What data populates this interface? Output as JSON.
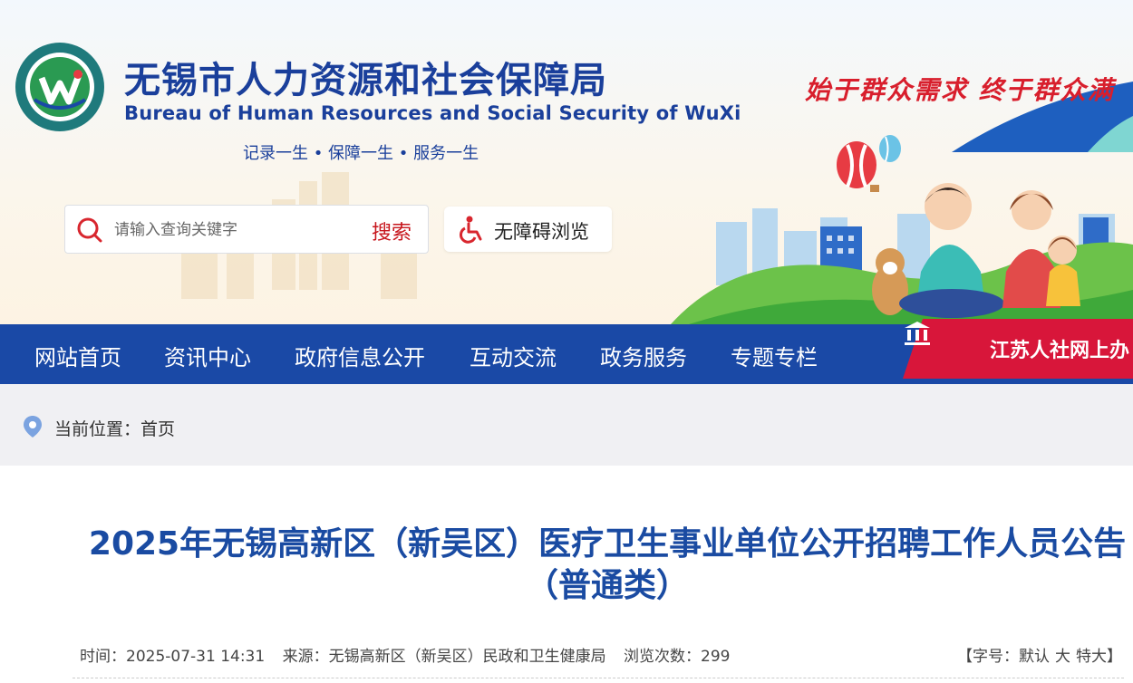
{
  "header": {
    "title": "无锡市人力资源和社会保障局",
    "subtitle": "Bureau of  Human Resources and Social Security of WuXi",
    "tagline": "记录一生 • 保障一生 • 服务一生",
    "slogan": "始于群众需求  终于群众满",
    "search": {
      "placeholder": "请输入查询关键字",
      "button": "搜索"
    },
    "accessibility": "无障碍浏览"
  },
  "nav": {
    "items": [
      "网站首页",
      "资讯中心",
      "政府信息公开",
      "互动交流",
      "政务服务",
      "专题专栏"
    ],
    "cta": "江苏人社网上办"
  },
  "breadcrumb": {
    "label": "当前位置：",
    "home": "首页"
  },
  "article": {
    "title_line1": "2025年无锡高新区（新吴区）医疗卫生事业单位公开招聘工作人员公告",
    "title_line2": "（普通类）",
    "time_label": "时间：",
    "time": "2025-07-31 14:31",
    "source_label": "来源：",
    "source": "无锡高新区（新吴区）民政和卫生健康局",
    "views_label": "浏览次数：",
    "views": "299",
    "fontsize_label": "【字号：",
    "fontsize_options": [
      "默认",
      "大",
      "特大"
    ],
    "fontsize_close": "】"
  },
  "colors": {
    "brand_blue": "#1a49a6",
    "title_blue": "#1a4ba2",
    "accent_red": "#d81e2c",
    "crumb_bg": "#f0f0f3"
  }
}
